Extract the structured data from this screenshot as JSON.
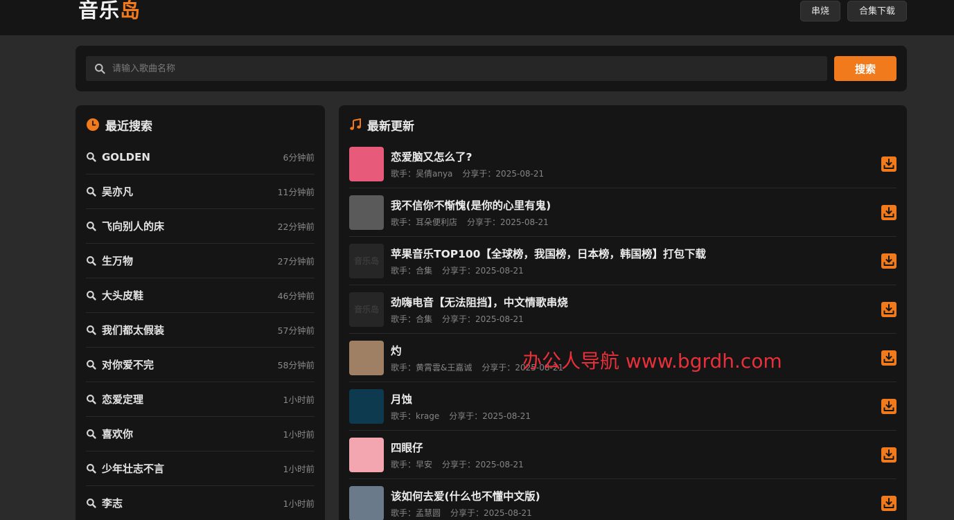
{
  "header": {
    "logo": {
      "char1": "音",
      "char2": "乐",
      "char3": "岛"
    },
    "nav": {
      "medley": "串烧",
      "bundle": "合集下载"
    }
  },
  "search": {
    "placeholder": "请输入歌曲名称",
    "button": "搜索"
  },
  "recent": {
    "title": "最近搜索",
    "items": [
      {
        "term": "GOLDEN",
        "time": "6分钟前"
      },
      {
        "term": "吴亦凡",
        "time": "11分钟前"
      },
      {
        "term": "飞向别人的床",
        "time": "22分钟前"
      },
      {
        "term": "生万物",
        "time": "27分钟前"
      },
      {
        "term": "大头皮鞋",
        "time": "46分钟前"
      },
      {
        "term": "我们都太假装",
        "time": "57分钟前"
      },
      {
        "term": "对你爱不完",
        "time": "58分钟前"
      },
      {
        "term": "恋爱定理",
        "time": "1小时前"
      },
      {
        "term": "喜欢你",
        "time": "1小时前"
      },
      {
        "term": "少年壮志不言",
        "time": "1小时前"
      },
      {
        "term": "李志",
        "time": "1小时前"
      }
    ]
  },
  "latest": {
    "title": "最新更新",
    "items": [
      {
        "title": "恋爱脑又怎么了?",
        "singer": "歌手：吴倩anya",
        "shared": "分享于：2025-08-21",
        "cover": "#e85a7a"
      },
      {
        "title": "我不信你不惭愧(是你的心里有鬼)",
        "singer": "歌手：耳朵便利店",
        "shared": "分享于：2025-08-21",
        "cover": "#5a5a5a"
      },
      {
        "title": "苹果音乐TOP100【全球榜，我国榜，日本榜，韩国榜】打包下载",
        "singer": "歌手：合集",
        "shared": "分享于：2025-08-21",
        "cover": "#262626",
        "placeholder": "音乐岛"
      },
      {
        "title": "劲嗨电音【无法阻挡】，中文情歌串烧",
        "singer": "歌手：合集",
        "shared": "分享于：2025-08-21",
        "cover": "#262626",
        "placeholder": "音乐岛"
      },
      {
        "title": "灼",
        "singer": "歌手：黄霄雲&王嘉诚",
        "shared": "分享于：2025-08-21",
        "cover": "#a08064"
      },
      {
        "title": "月蚀",
        "singer": "歌手：krage",
        "shared": "分享于：2025-08-21",
        "cover": "#0e3a50"
      },
      {
        "title": "四眼仔",
        "singer": "歌手：早安",
        "shared": "分享于：2025-08-21",
        "cover": "#f3a5b0"
      },
      {
        "title": "该如何去爱(什么也不懂中文版)",
        "singer": "歌手：孟慧圆",
        "shared": "分享于：2025-08-21",
        "cover": "#6a7a8a"
      }
    ]
  },
  "watermark": "办公人导航 www.bgrdh.com",
  "colors": {
    "accent": "#f07a1c",
    "panel": "#151515",
    "page": "#2b2b2b",
    "watermark": "#e8303a"
  },
  "icons": {
    "search": "search-icon",
    "clock": "clock-icon",
    "music": "music-note-icon",
    "download": "download-icon"
  }
}
